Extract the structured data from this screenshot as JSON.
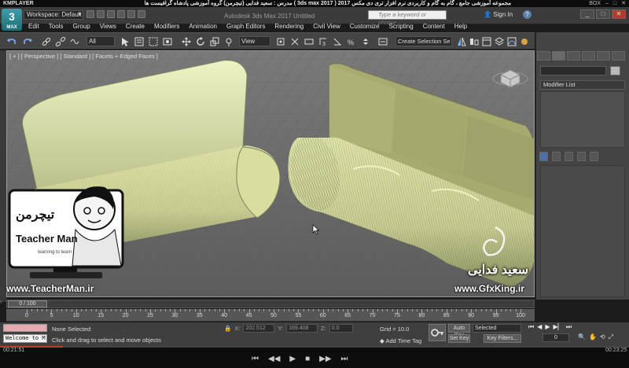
{
  "player": {
    "logo": "KMPLAYER",
    "title": "مجموعه آموزشی جامع ، گام به گام و کاربردی نرم افزار تری دی مکس 2017 ( 3ds max 2017 )  مدرس : سعید فدایی (تیچرمن) گروه آموزشی پادشاه گرافیست ها",
    "right_text": "BOX",
    "time_elapsed": "00:21:51",
    "time_total": "00:23:25",
    "progress": 0.1
  },
  "app": {
    "button_label": "3",
    "button_sub": "MAX",
    "workspace": "Workspace: Default",
    "title": "Autodesk 3ds Max 2017     Untitled",
    "search_placeholder": "Type a keyword or phrase",
    "sign_in": "Sign In",
    "help": "?",
    "window_controls": [
      "_",
      "□",
      "✕"
    ]
  },
  "menu": [
    "Edit",
    "Tools",
    "Group",
    "Views",
    "Create",
    "Modifiers",
    "Animation",
    "Graph Editors",
    "Rendering",
    "Civil View",
    "Customize",
    "Scripting",
    "Content",
    "Help"
  ],
  "toolbar": {
    "selection_filter": "All",
    "reference_coord": "View",
    "create_selection_set": "Create Selection Se"
  },
  "viewport": {
    "label": "[ + ] [ Perspective ] [ Standard ] [ Facets + Edged Faces ]",
    "background": "#6e6e6e",
    "object_color": "#e4eab0"
  },
  "command_panel": {
    "modifier_list": "Modifier List"
  },
  "time_slider": {
    "current": "0 / 100",
    "current_frame": 0,
    "total_frames": 100
  },
  "trackbar": {
    "labels": [
      "0",
      "5",
      "10",
      "15",
      "20",
      "25",
      "30",
      "35",
      "40",
      "45",
      "50",
      "55",
      "60",
      "65",
      "70",
      "75",
      "80",
      "85",
      "90",
      "95",
      "100"
    ]
  },
  "status": {
    "maxscript_text": "Welcome to M",
    "selection": "None Selected",
    "prompt": "Click and drag to select and move objects",
    "x_label": "X:",
    "x_value": "202.512",
    "y_label": "Y:",
    "y_value": "169.408",
    "z_label": "Z:",
    "z_value": "0.0",
    "grid": "Grid = 10.0",
    "add_time_tag": "Add Time Tag",
    "auto_key": "Auto Key",
    "set_key": "Set Key",
    "selected": "Selected",
    "key_filters": "Key Filters...",
    "frame": "0"
  },
  "watermark": {
    "url_left": "www.TeacherMan.ir",
    "url_right": "www.GfxKing.ir",
    "author": "سعید فدایی",
    "card_brand": "Teacher Man",
    "card_fa": "تیچرمن",
    "card_tagline": "learning to learn"
  }
}
